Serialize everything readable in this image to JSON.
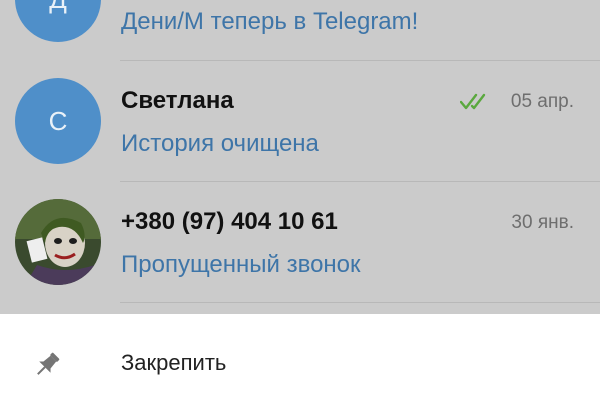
{
  "chats": [
    {
      "avatar_letter": "Д",
      "preview": "Дени/М теперь в Telegram!"
    },
    {
      "avatar_letter": "С",
      "name": "Светлана",
      "preview": "История очищена",
      "date": "05 апр.",
      "read_status": "read"
    },
    {
      "name": "+380 (97) 404 10 61",
      "preview": "Пропущенный звонок",
      "date": "30 янв."
    }
  ],
  "menu": {
    "pin_label": "Закрепить"
  },
  "colors": {
    "avatar_blue": "#4f8fc9",
    "preview_blue": "#3e75a8",
    "check_green": "#5aa83e",
    "dim_overlay": "#cbcbcb",
    "sheet_bg": "#ffffff"
  },
  "icons": {
    "pin": "pin-icon",
    "read": "double-check-icon"
  }
}
